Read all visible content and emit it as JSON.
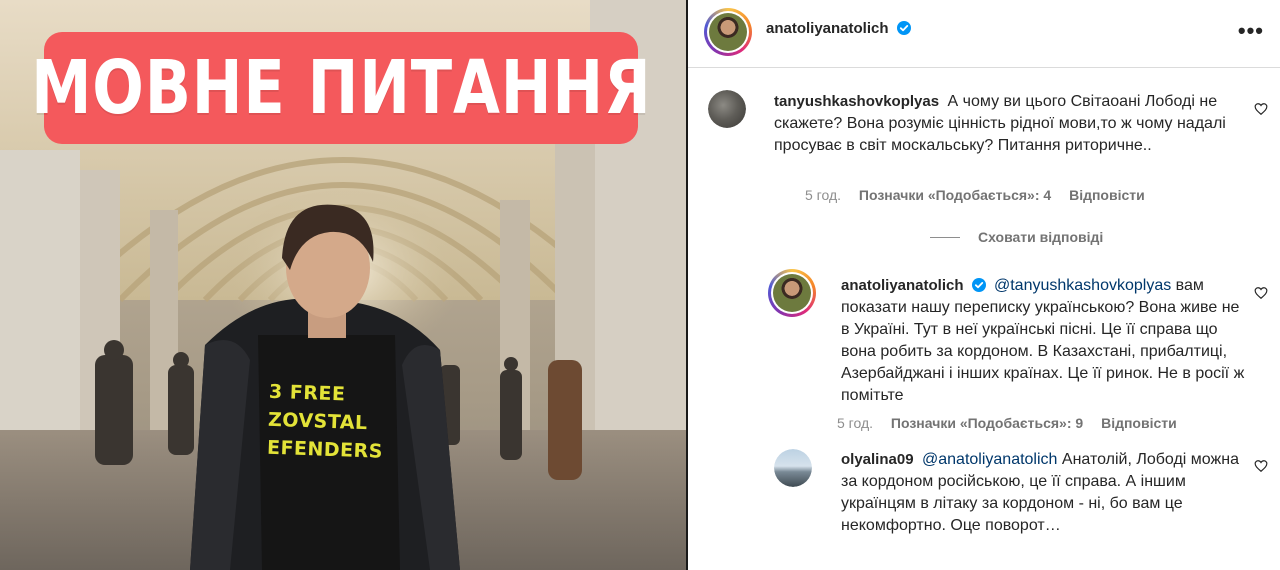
{
  "image": {
    "title_banner": "МОВНЕ ПИТАННЯ",
    "shirt_lines": [
      "3 FREE",
      "ZOVSTAL",
      "EFENDERS"
    ]
  },
  "post": {
    "author": "anatoliyanatolich",
    "verified": true,
    "more_icon": "more-options-icon"
  },
  "comments": [
    {
      "username": "tanyushkashovkoplyas",
      "text": "А чому ви цього Світаоані Лободі не скажете? Вона розуміє цінність рідної мови,то ж чому надалі просуває в світ москальську? Питання риторичне..",
      "time": "5 год.",
      "likes": "Позначки «Подобається»: 4",
      "reply": "Відповісти"
    }
  ],
  "hide_replies": "Сховати відповіді",
  "replies": [
    {
      "username": "anatoliyanatolich",
      "verified": true,
      "mention": "@tanyushkashovkoplyas",
      "text": "вам показати нашу переписку українською? Вона живе не в Україні. Тут в неї українські пісні. Це її справа що вона робить за кордоном. В Казахстані, прибалтиці, Азербайджані і інших країнах. Це її ринок. Не в росії ж помітьте",
      "time": "5 год.",
      "likes": "Позначки «Подобається»: 9",
      "reply": "Відповісти"
    },
    {
      "username": "olyalina09",
      "mention": "@anatoliyanatolich",
      "text": "Анатолій, Лободі можна за кордоном російською, це її справа. А іншим українцям в літаку за кордоном - ні, бо вам це некомфортно. Оце поворот…"
    }
  ],
  "colors": {
    "banner": "#f4595c",
    "verified": "#0095f6",
    "mention": "#00376b",
    "meta": "#8e8e8e"
  }
}
